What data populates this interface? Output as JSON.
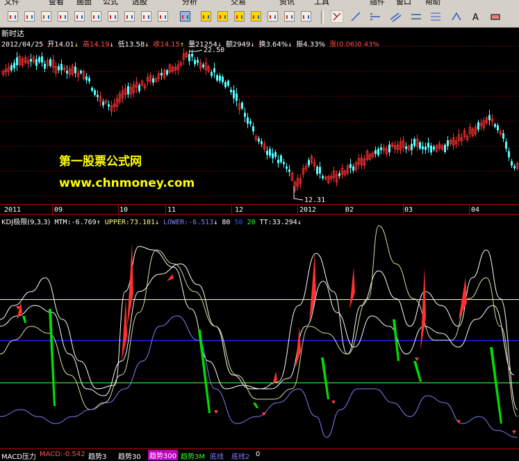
{
  "menu": [
    "文件",
    "查看",
    "画面",
    "公式",
    "选股",
    "分析",
    "交易",
    "资讯",
    "工具",
    "插件",
    "窗口",
    "帮助"
  ],
  "header": {
    "stock_name": "新时达",
    "date": "2012/04/25",
    "open": "开14.01",
    "high": "高14.19",
    "low": "低13.58",
    "close": "收14.15",
    "volume": "量21254",
    "amount": "额2949",
    "turnover": "换3.64%",
    "amplitude": "振4.33%",
    "change": "涨(0.06)0.43%"
  },
  "price_panel": {
    "high_label": "22.50",
    "low_label": "12.31"
  },
  "watermark": {
    "title": "第一股票公式网",
    "url": "www.chnmoney.com"
  },
  "time_axis": [
    "2011",
    "09",
    "10",
    "11",
    "12",
    "2012",
    "02",
    "03",
    "04"
  ],
  "indicator": {
    "name": "KDJ极限(9,3,3)",
    "mtm": "MTM:-6.769",
    "upper": "UPPER:73.101",
    "lower": "LOWER:-6.513",
    "l80": "80",
    "l50": "50",
    "l20": "20",
    "tt": "TT:33.294"
  },
  "bottom_tabs": {
    "macd": "MACD压力",
    "macd_val": "MACD:-0.542",
    "trend3": "趋势3",
    "trend30": "趋势30",
    "trend300": "趋势300",
    "trend3m": "趋势3M",
    "base1": "底线",
    "base2": "底线2",
    "zero": "0"
  },
  "colors": {
    "up": "#ff3232",
    "down": "#54ffff",
    "axis": "#c00000",
    "yellow": "#ffff00",
    "green": "#00e000",
    "blue": "#2020ff"
  }
}
